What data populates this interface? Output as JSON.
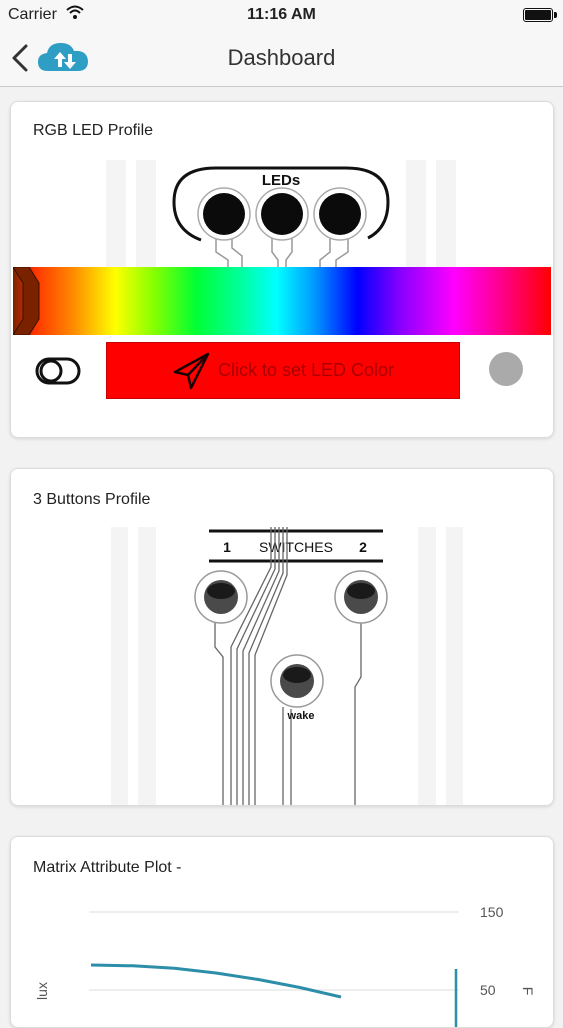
{
  "statusbar": {
    "carrier": "Carrier",
    "time": "11:16 AM"
  },
  "navbar": {
    "title": "Dashboard"
  },
  "rgb_card": {
    "title": "RGB LED Profile",
    "leds_label": "LEDs",
    "button_label": "Click to set LED Color"
  },
  "buttons_card": {
    "title": "3 Buttons Profile",
    "switches_label": "SWITCHES",
    "switch1": "1",
    "switch2": "2",
    "wake_label": "wake"
  },
  "chart_card": {
    "title": "Matrix Attribute Plot -"
  },
  "chart_data": {
    "type": "line",
    "title": "Matrix Attribute Plot -",
    "ylabel": "lux",
    "y2label": "F",
    "y2_ticks": [
      150,
      50
    ],
    "series": [
      {
        "values": [
          1.0,
          0.99,
          0.96,
          0.9,
          0.82,
          0.72,
          0.6
        ]
      }
    ]
  },
  "colors": {
    "button_red": "#ff0000",
    "accent": "#2c8ea8",
    "dot_gray": "#aaaaaa"
  }
}
